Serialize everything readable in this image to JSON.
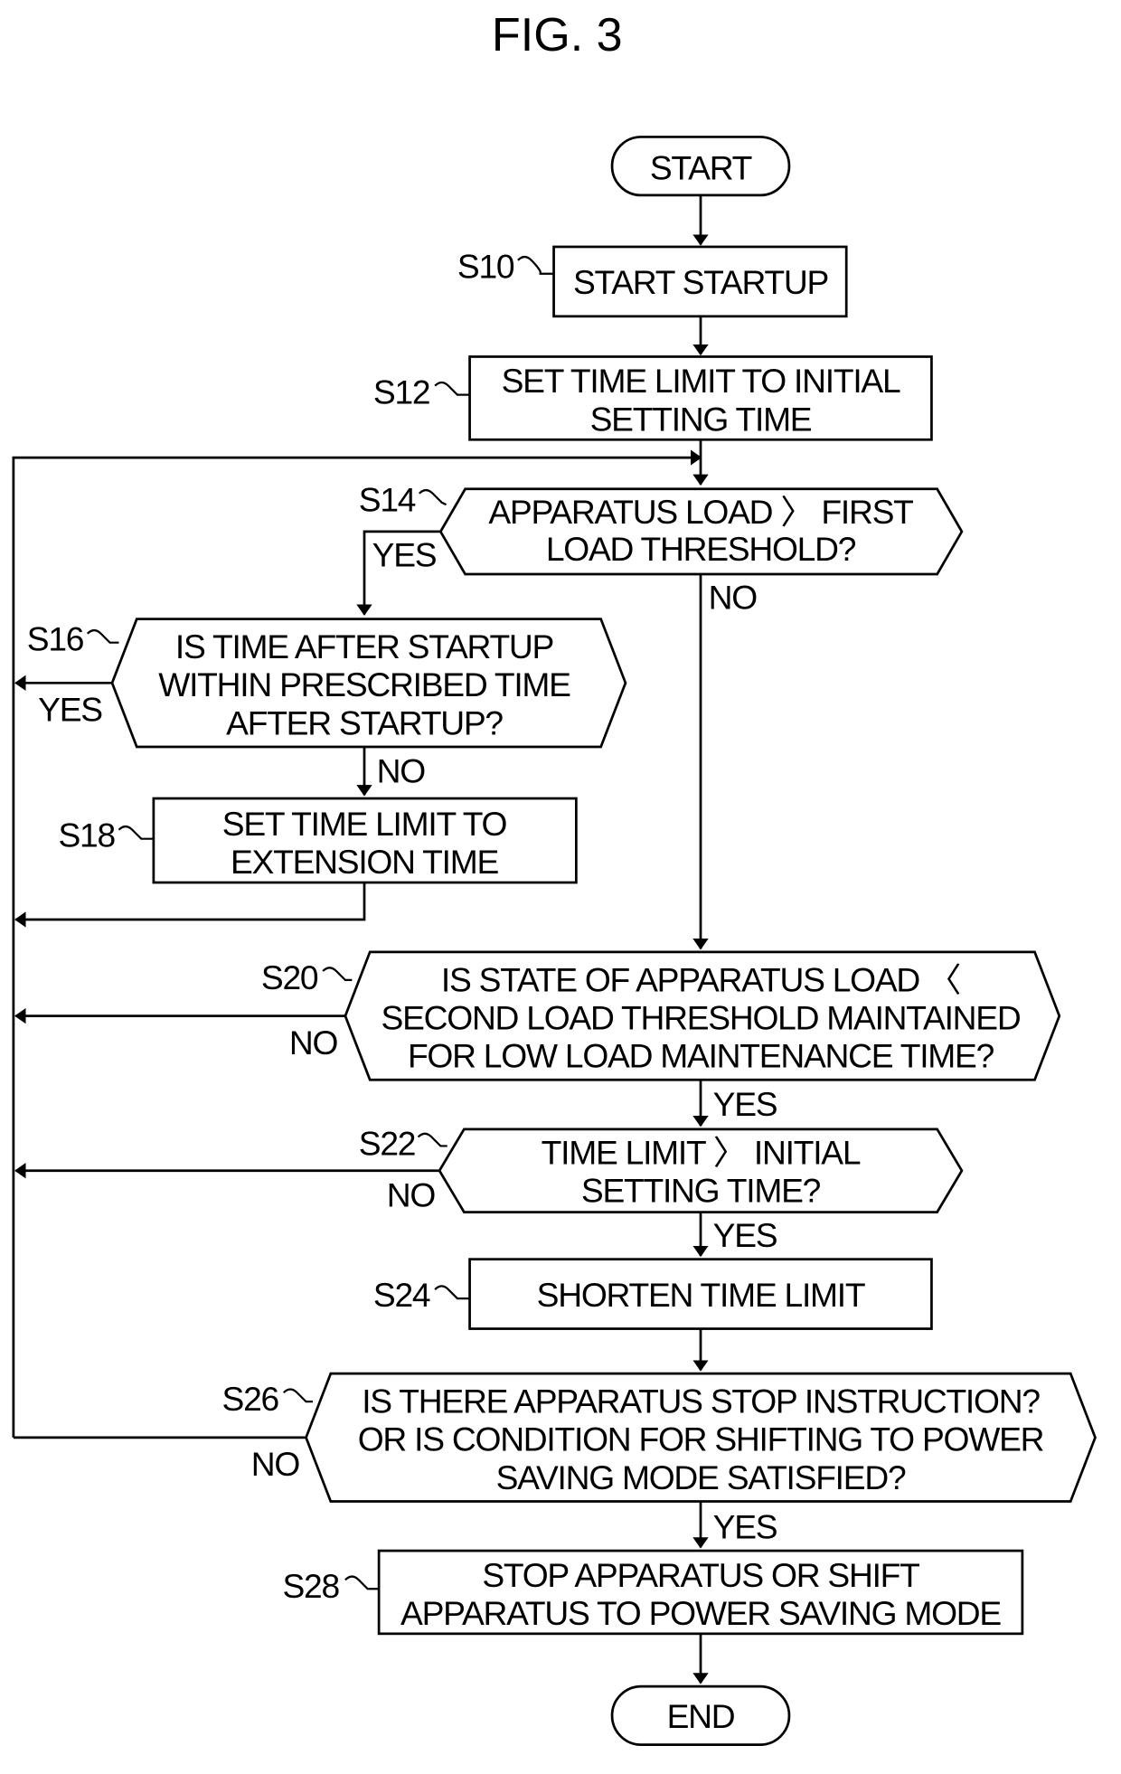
{
  "figure": {
    "title": "FIG. 3",
    "start": "START",
    "end": "END",
    "steps": {
      "s10": {
        "id": "S10",
        "lines": [
          "START STARTUP"
        ]
      },
      "s12": {
        "id": "S12",
        "lines": [
          "SET TIME LIMIT TO INITIAL",
          "SETTING TIME"
        ]
      },
      "s14": {
        "id": "S14",
        "lines": [
          "APPARATUS LOAD 〉 FIRST",
          "LOAD THRESHOLD?"
        ]
      },
      "s16": {
        "id": "S16",
        "lines": [
          "IS TIME AFTER STARTUP",
          "WITHIN PRESCRIBED TIME",
          "AFTER STARTUP?"
        ]
      },
      "s18": {
        "id": "S18",
        "lines": [
          "SET TIME LIMIT TO",
          "EXTENSION TIME"
        ]
      },
      "s20": {
        "id": "S20",
        "lines": [
          "IS STATE OF APPARATUS LOAD 〈",
          "SECOND LOAD THRESHOLD MAINTAINED",
          "FOR LOW LOAD MAINTENANCE TIME?"
        ]
      },
      "s22": {
        "id": "S22",
        "lines": [
          "TIME LIMIT 〉 INITIAL",
          "SETTING TIME?"
        ]
      },
      "s24": {
        "id": "S24",
        "lines": [
          "SHORTEN TIME LIMIT"
        ]
      },
      "s26": {
        "id": "S26",
        "lines": [
          "IS THERE APPARATUS STOP INSTRUCTION?",
          "OR IS CONDITION FOR SHIFTING TO POWER",
          "SAVING MODE SATISFIED?"
        ]
      },
      "s28": {
        "id": "S28",
        "lines": [
          "STOP APPARATUS OR SHIFT",
          "APPARATUS TO POWER SAVING MODE"
        ]
      }
    },
    "branch_labels": {
      "s14_yes": "YES",
      "s14_no": "NO",
      "s16_yes": "YES",
      "s16_no": "NO",
      "s20_no": "NO",
      "s20_yes": "YES",
      "s22_no": "NO",
      "s22_yes": "YES",
      "s26_no": "NO",
      "s26_yes": "YES"
    }
  }
}
